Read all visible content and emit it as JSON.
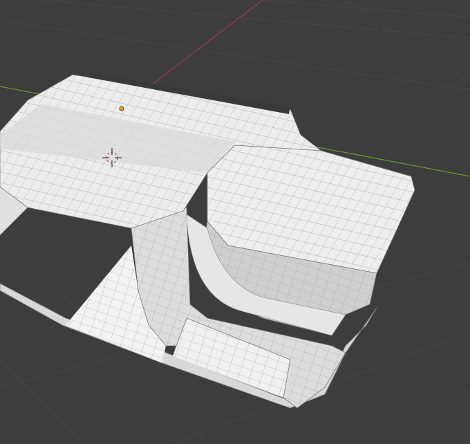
{
  "viewport": {
    "background": "#3d3d3d",
    "grid_color": "#474747",
    "axis_x_color": "#a23a48",
    "axis_y_color": "#6f9a2c",
    "mesh_color": "#ececec",
    "mesh_shade": "#c9c9c9",
    "wire_color": "#9a9a9a",
    "origin_color": "#f0a020",
    "cursor_icon": "3d-cursor-icon"
  }
}
